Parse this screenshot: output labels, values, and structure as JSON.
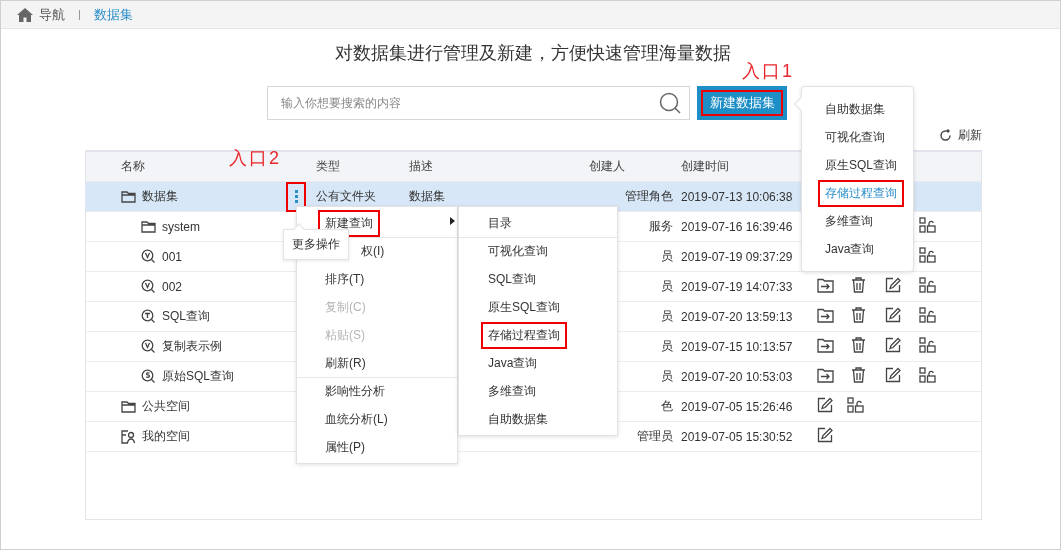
{
  "breadcrumb": {
    "items": [
      {
        "label": "导航",
        "selected": false
      },
      {
        "label": "数据集",
        "selected": true
      }
    ]
  },
  "heading": "对数据集进行管理及新建，方便快速管理海量数据",
  "search": {
    "placeholder": "输入你想要搜索的内容"
  },
  "new_button": {
    "label": "新建数据集",
    "highlighted": true
  },
  "annotations": [
    "入口1",
    "入口2"
  ],
  "refresh": "刷新",
  "table": {
    "columns": [
      "名称",
      "类型",
      "描述",
      "创建人",
      "创建时间"
    ],
    "rows": [
      {
        "name": "数据集",
        "kind": "folder",
        "selected": true,
        "more_button": {
          "highlighted": true
        },
        "type": "公有文件夹",
        "description": "数据集",
        "creator": "管理角色",
        "time": "2019-07-13 10:06:38",
        "actions": [],
        "children": [
          {
            "name": "system",
            "kind": "folder",
            "selected": false,
            "creator": "服务",
            "time": "2019-07-16 16:39:46",
            "actions": [
              {
                "kind": "permission"
              }
            ]
          },
          {
            "name": "001",
            "kind": "visual",
            "selected": false,
            "creator": "员",
            "time": "2019-07-19 09:37:29",
            "actions": [
              {
                "kind": "permission"
              }
            ]
          },
          {
            "name": "002",
            "kind": "visual",
            "selected": false,
            "creator": "员",
            "time": "2019-07-19 14:07:33",
            "actions": [
              {
                "kind": "move"
              },
              {
                "kind": "delete"
              },
              {
                "kind": "edit"
              },
              {
                "kind": "permission"
              }
            ]
          },
          {
            "name": "SQL查询",
            "kind": "sql",
            "selected": false,
            "creator": "员",
            "time": "2019-07-20 13:59:13",
            "actions": [
              {
                "kind": "move"
              },
              {
                "kind": "delete"
              },
              {
                "kind": "edit"
              },
              {
                "kind": "permission"
              }
            ]
          },
          {
            "name": "复制表示例",
            "kind": "visual",
            "selected": false,
            "creator": "员",
            "time": "2019-07-15 10:13:57",
            "actions": [
              {
                "kind": "move"
              },
              {
                "kind": "delete"
              },
              {
                "kind": "edit"
              },
              {
                "kind": "permission"
              }
            ]
          },
          {
            "name": "原始SQL查询",
            "kind": "native",
            "selected": false,
            "creator": "员",
            "time": "2019-07-20 10:53:03",
            "actions": [
              {
                "kind": "move"
              },
              {
                "kind": "delete"
              },
              {
                "kind": "edit"
              },
              {
                "kind": "permission"
              }
            ]
          }
        ]
      },
      {
        "name": "公共空间",
        "kind": "folder",
        "selected": false,
        "creator": "色",
        "time": "2019-07-05 15:26:46",
        "actions": [
          {
            "kind": "edit"
          },
          {
            "kind": "permission"
          }
        ]
      },
      {
        "name": "我的空间",
        "kind": "personal",
        "selected": false,
        "creator": "管理员",
        "time": "2019-07-05 15:30:52",
        "actions": [
          {
            "kind": "edit"
          }
        ]
      }
    ]
  },
  "new_menu": {
    "items": [
      {
        "label": "自助数据集",
        "selected": false,
        "highlighted": false
      },
      {
        "label": "可视化查询",
        "selected": false,
        "highlighted": false
      },
      {
        "label": "原生SQL查询",
        "selected": false,
        "highlighted": false
      },
      {
        "label": "存储过程查询",
        "selected": true,
        "highlighted": true
      },
      {
        "label": "多维查询",
        "selected": false,
        "highlighted": false
      },
      {
        "label": "Java查询",
        "selected": false,
        "highlighted": false
      }
    ]
  },
  "context_menu": {
    "items": [
      {
        "kind": "item",
        "label": "新建查询",
        "disabled": false,
        "highlighted": true,
        "submenu": true,
        "separator_above": false
      },
      {
        "kind": "partial",
        "label": "权(I)",
        "disabled": false,
        "highlighted": false,
        "submenu": false,
        "separator_above": true
      },
      {
        "kind": "item",
        "label": "排序(T)",
        "disabled": false,
        "highlighted": false,
        "submenu": false,
        "separator_above": false
      },
      {
        "kind": "item",
        "label": "复制(C)",
        "disabled": true,
        "highlighted": false,
        "submenu": false,
        "separator_above": false
      },
      {
        "kind": "item",
        "label": "粘贴(S)",
        "disabled": true,
        "highlighted": false,
        "submenu": false,
        "separator_above": false
      },
      {
        "kind": "item",
        "label": "刷新(R)",
        "disabled": false,
        "highlighted": false,
        "submenu": false,
        "separator_above": false
      },
      {
        "kind": "item",
        "label": "影响性分析",
        "disabled": false,
        "highlighted": false,
        "submenu": false,
        "separator_above": true
      },
      {
        "kind": "item",
        "label": "血统分析(L)",
        "disabled": false,
        "highlighted": false,
        "submenu": false,
        "separator_above": false
      },
      {
        "kind": "item",
        "label": "属性(P)",
        "disabled": false,
        "highlighted": false,
        "submenu": false,
        "separator_above": false
      }
    ]
  },
  "submenu": {
    "items": [
      {
        "label": "目录",
        "highlighted": false,
        "separator_above": false
      },
      {
        "label": "可视化查询",
        "highlighted": false,
        "separator_above": true
      },
      {
        "label": "SQL查询",
        "highlighted": false,
        "separator_above": false
      },
      {
        "label": "原生SQL查询",
        "highlighted": false,
        "separator_above": false
      },
      {
        "label": "存储过程查询",
        "highlighted": true,
        "separator_above": false
      },
      {
        "label": "Java查询",
        "highlighted": false,
        "separator_above": false
      },
      {
        "label": "多维查询",
        "highlighted": false,
        "separator_above": false
      },
      {
        "label": "自助数据集",
        "highlighted": false,
        "separator_above": false
      }
    ]
  },
  "tooltip": "更多操作"
}
